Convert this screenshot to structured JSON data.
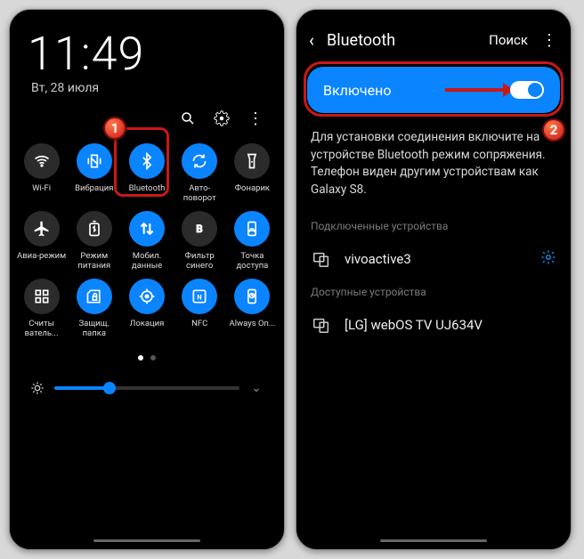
{
  "left": {
    "clock": "11:49",
    "date": "Вт, 28 июля",
    "badge1": "1",
    "tiles": [
      {
        "label": "Wi-Fi",
        "on": false,
        "icon": "wifi"
      },
      {
        "label": "Вибрация",
        "on": true,
        "icon": "vibration"
      },
      {
        "label": "Bluetooth",
        "on": true,
        "icon": "bluetooth"
      },
      {
        "label": "Авто-поворот",
        "on": true,
        "icon": "rotate"
      },
      {
        "label": "Фонарик",
        "on": false,
        "icon": "flashlight"
      },
      {
        "label": "Авиа-режим",
        "on": false,
        "icon": "airplane"
      },
      {
        "label": "Режим питания",
        "on": false,
        "icon": "battery"
      },
      {
        "label": "Мобил. данные",
        "on": true,
        "icon": "data"
      },
      {
        "label": "Фильтр синего",
        "on": false,
        "icon": "bluefilter"
      },
      {
        "label": "Точка доступа",
        "on": true,
        "icon": "hotspot"
      },
      {
        "label": "Считы ватель...",
        "on": false,
        "icon": "scan"
      },
      {
        "label": "Защищ. папка",
        "on": true,
        "icon": "secure"
      },
      {
        "label": "Локация",
        "on": true,
        "icon": "location"
      },
      {
        "label": "NFC",
        "on": true,
        "icon": "nfc"
      },
      {
        "label": "Always On...",
        "on": true,
        "icon": "aod"
      }
    ]
  },
  "right": {
    "title": "Bluetooth",
    "search": "Поиск",
    "toggle_label": "Включено",
    "badge2": "2",
    "info": "Для установки соединения включите на устройстве Bluetooth режим сопряжения. Телефон виден другим устройствам как Galaxy S8.",
    "paired_header": "Подключенные устройства",
    "avail_header": "Доступные устройства",
    "paired_device": "vivoactive3",
    "avail_device": "[LG] webOS TV UJ634V"
  }
}
